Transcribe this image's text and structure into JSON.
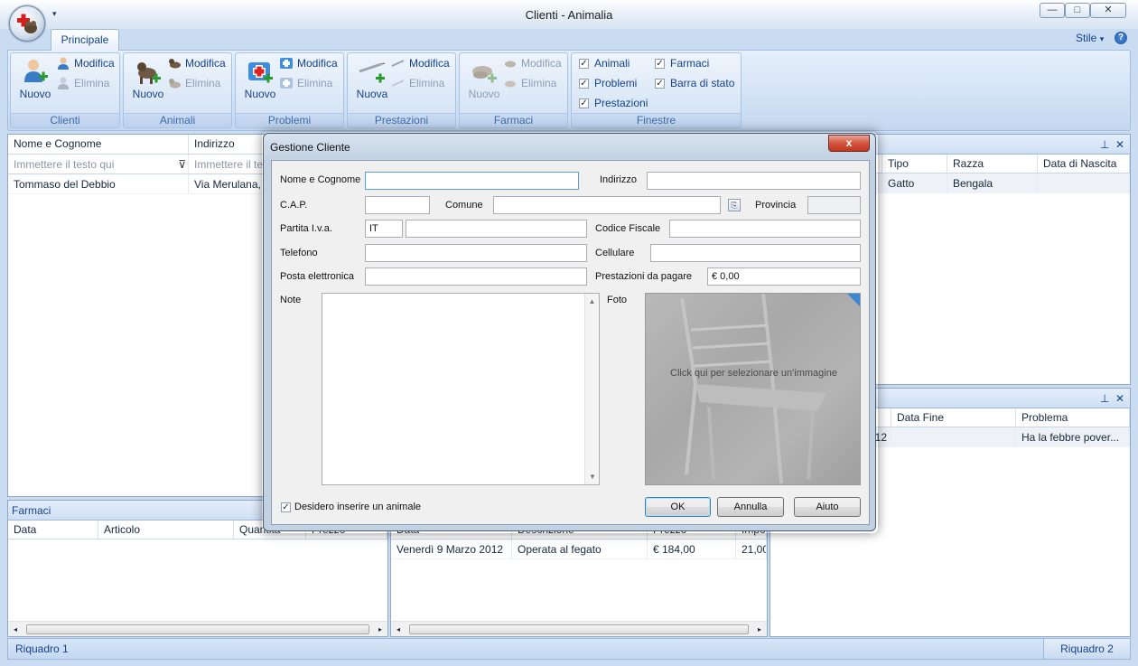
{
  "window": {
    "title": "Clienti - Animalia",
    "controls": {
      "minimize": "—",
      "maximize": "□",
      "close": "✕"
    }
  },
  "ribbon": {
    "tabs": [
      {
        "label": "Principale",
        "selected": true
      }
    ],
    "style_menu": "Stile",
    "help_label": "?",
    "groups": {
      "clienti": {
        "caption": "Clienti",
        "new_label": "Nuovo",
        "edit_label": "Modifica",
        "delete_label": "Elimina"
      },
      "animali": {
        "caption": "Animali",
        "new_label": "Nuovo",
        "edit_label": "Modifica",
        "delete_label": "Elimina"
      },
      "problemi": {
        "caption": "Problemi",
        "new_label": "Nuovo",
        "edit_label": "Modifica",
        "delete_label": "Elimina"
      },
      "prestazioni": {
        "caption": "Prestazioni",
        "new_label": "Nuova",
        "edit_label": "Modifica",
        "delete_label": "Elimina"
      },
      "farmaci": {
        "caption": "Farmaci",
        "new_label": "Nuovo",
        "edit_label": "Modifica",
        "delete_label": "Elimina"
      },
      "finestre": {
        "caption": "Finestre",
        "checks": [
          {
            "label": "Animali",
            "checked": true
          },
          {
            "label": "Farmaci",
            "checked": true
          },
          {
            "label": "Problemi",
            "checked": true
          },
          {
            "label": "Barra di stato",
            "checked": true
          },
          {
            "label": "Prestazioni",
            "checked": true
          }
        ]
      }
    }
  },
  "clients_grid": {
    "columns": [
      "Nome e Cognome",
      "Indirizzo"
    ],
    "filter_placeholder": "Immettere il testo qui",
    "filter_placeholder_2": "Immettere il te",
    "rows": [
      {
        "name": "Tommaso del Debbio",
        "address": "Via Merulana, 5"
      }
    ]
  },
  "animals_grid": {
    "columns": [
      "Tipo",
      "Razza",
      "Data di Nascita"
    ],
    "rows": [
      {
        "type": "Gatto",
        "breed": "Bengala",
        "birth": ""
      }
    ]
  },
  "problems_grid": {
    "columns": [
      "Data Fine",
      "Problema"
    ],
    "rows": [
      {
        "start_fragment": "12",
        "end": "",
        "problem": "Ha la febbre pover..."
      }
    ]
  },
  "farmaci_panel": {
    "title": "Farmaci",
    "columns": [
      "Data",
      "Articolo",
      "Quantità",
      "Prezzo"
    ]
  },
  "prestazioni_grid": {
    "columns": [
      "Data",
      "Descrizione",
      "Prezzo",
      "Impo"
    ],
    "rows": [
      {
        "date": "Venerdì  9 Marzo 2012",
        "description": "Operata al fegato",
        "price": "€ 184,00",
        "amount": "21,00"
      }
    ]
  },
  "statusbar": {
    "left": "Riquadro 1",
    "right": "Riquadro 2"
  },
  "dialog": {
    "title": "Gestione Cliente",
    "close_label": "x",
    "fields": {
      "name_label": "Nome e Cognome",
      "name_value": "",
      "address_label": "Indirizzo",
      "address_value": "",
      "cap_label": "C.A.P.",
      "cap_value": "",
      "comune_label": "Comune",
      "comune_value": "",
      "provincia_label": "Provincia",
      "provincia_value": "",
      "piva_label": "Partita I.v.a.",
      "piva_prefix": "IT",
      "piva_value": "",
      "cf_label": "Codice Fiscale",
      "cf_value": "",
      "phone_label": "Telefono",
      "phone_value": "",
      "mobile_label": "Cellulare",
      "mobile_value": "",
      "email_label": "Posta elettronica",
      "email_value": "",
      "due_label": "Prestazioni da pagare",
      "due_value": "€ 0,00",
      "notes_label": "Note",
      "notes_value": "",
      "photo_label": "Foto",
      "photo_hint": "Click qui per selezionare un'immagine"
    },
    "add_animal_label": "Desidero inserire un animale",
    "add_animal_checked": true,
    "buttons": {
      "ok": "OK",
      "cancel": "Annulla",
      "help": "Aiuto"
    }
  },
  "colors": {
    "accent": "#15428b",
    "ribbon_bg": "#d2e2f5",
    "close_red": "#c3361f"
  }
}
